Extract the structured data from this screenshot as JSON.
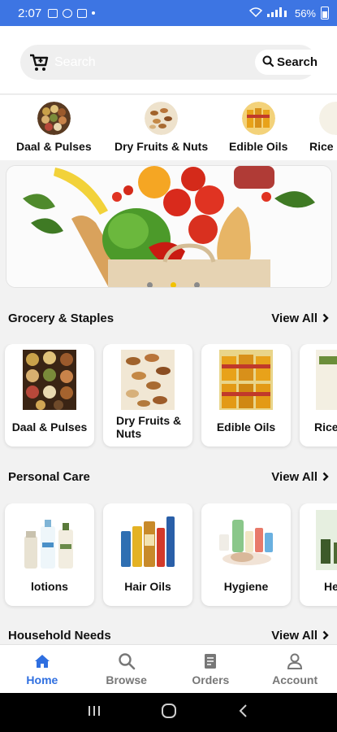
{
  "status_bar": {
    "time": "2:07",
    "battery": "56%"
  },
  "search": {
    "placeholder": "Search",
    "button_label": "Search"
  },
  "categories": [
    {
      "label": "Daal & Pulses",
      "icon": "daal-pulses-thumb"
    },
    {
      "label": "Dry Fruits & Nuts",
      "icon": "dry-fruits-thumb"
    },
    {
      "label": "Edible Oils",
      "icon": "edible-oils-thumb"
    },
    {
      "label": "Rice",
      "icon": "rice-thumb"
    }
  ],
  "banner": {
    "slide_count": 3,
    "active_slide": 2
  },
  "sections": [
    {
      "title": "Grocery & Staples",
      "view_all": "View All",
      "cards": [
        {
          "label": "Daal & Pulses"
        },
        {
          "label": "Dry Fruits & Nuts"
        },
        {
          "label": "Edible Oils"
        },
        {
          "label": "Rice & cauli"
        }
      ]
    },
    {
      "title": "Personal Care",
      "view_all": "View All",
      "cards": [
        {
          "label": "lotions"
        },
        {
          "label": "Hair Oils"
        },
        {
          "label": "Hygiene"
        },
        {
          "label": "He"
        }
      ]
    },
    {
      "title": "Household Needs",
      "view_all": "View All"
    }
  ],
  "bottom_nav": [
    {
      "label": "Home",
      "icon": "home-icon",
      "active": true
    },
    {
      "label": "Browse",
      "icon": "search-icon",
      "active": false
    },
    {
      "label": "Orders",
      "icon": "orders-icon",
      "active": false
    },
    {
      "label": "Account",
      "icon": "account-icon",
      "active": false
    }
  ],
  "colors": {
    "accent": "#3d75e3",
    "nav_active": "#2f6fe0",
    "dot_active": "#f2c200"
  }
}
